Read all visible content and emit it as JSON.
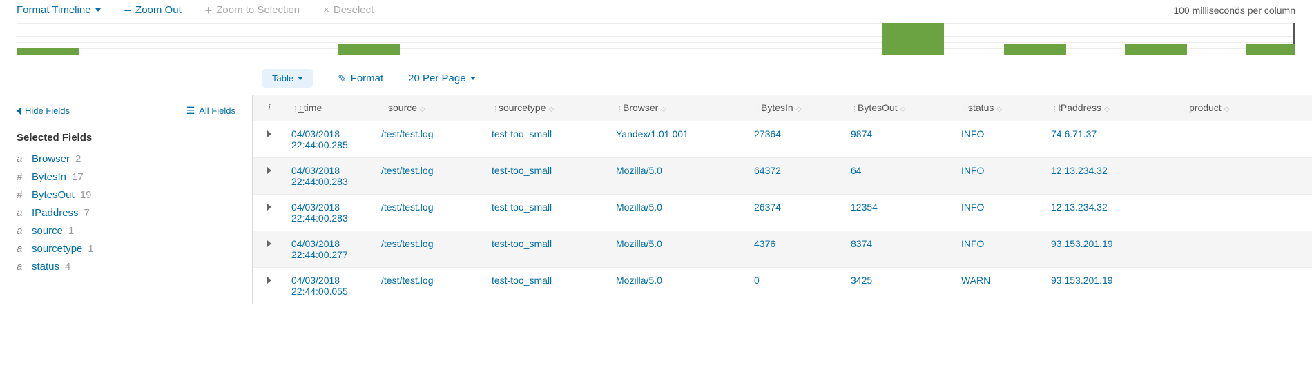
{
  "toolbar": {
    "format_timeline": "Format Timeline",
    "zoom_out": "Zoom Out",
    "zoom_to_sel": "Zoom to Selection",
    "deselect": "Deselect",
    "scale_text": "100 milliseconds per column"
  },
  "table_tools": {
    "table_label": "Table",
    "format_label": "Format",
    "per_page_label": "20 Per Page"
  },
  "sidebar": {
    "hide_fields": "Hide Fields",
    "all_fields": "All Fields",
    "selected_heading": "Selected Fields",
    "fields": [
      {
        "type": "a",
        "name": "Browser",
        "count": "2"
      },
      {
        "type": "#",
        "name": "BytesIn",
        "count": "17"
      },
      {
        "type": "#",
        "name": "BytesOut",
        "count": "19"
      },
      {
        "type": "a",
        "name": "IPaddress",
        "count": "7"
      },
      {
        "type": "a",
        "name": "source",
        "count": "1"
      },
      {
        "type": "a",
        "name": "sourcetype",
        "count": "1"
      },
      {
        "type": "a",
        "name": "status",
        "count": "4"
      }
    ]
  },
  "columns": {
    "time": "_time",
    "source": "source",
    "sourcetype": "sourcetype",
    "browser": "Browser",
    "bytesin": "BytesIn",
    "bytesout": "BytesOut",
    "status": "status",
    "ip": "IPaddress",
    "product": "product"
  },
  "rows": [
    {
      "time": "04/03/2018 22:44:00.285",
      "source": "/test/test.log",
      "sourcetype": "test-too_small",
      "browser": "Yandex/1.01.001",
      "bytesin": "27364",
      "bytesout": "9874",
      "status": "INFO",
      "ip": "74.6.71.37",
      "product": ""
    },
    {
      "time": "04/03/2018 22:44:00.283",
      "source": "/test/test.log",
      "sourcetype": "test-too_small",
      "browser": "Mozilla/5.0",
      "bytesin": "64372",
      "bytesout": "64",
      "status": "INFO",
      "ip": "12.13.234.32",
      "product": ""
    },
    {
      "time": "04/03/2018 22:44:00.283",
      "source": "/test/test.log",
      "sourcetype": "test-too_small",
      "browser": "Mozilla/5.0",
      "bytesin": "26374",
      "bytesout": "12354",
      "status": "INFO",
      "ip": "12.13.234.32",
      "product": ""
    },
    {
      "time": "04/03/2018 22:44:00.277",
      "source": "/test/test.log",
      "sourcetype": "test-too_small",
      "browser": "Mozilla/5.0",
      "bytesin": "4376",
      "bytesout": "8374",
      "status": "INFO",
      "ip": "93.153.201.19",
      "product": ""
    },
    {
      "time": "04/03/2018 22:44:00.055",
      "source": "/test/test.log",
      "sourcetype": "test-too_small",
      "browser": "Mozilla/5.0",
      "bytesin": "0",
      "bytesout": "3425",
      "status": "WARN",
      "ip": "93.153.201.19",
      "product": ""
    }
  ]
}
